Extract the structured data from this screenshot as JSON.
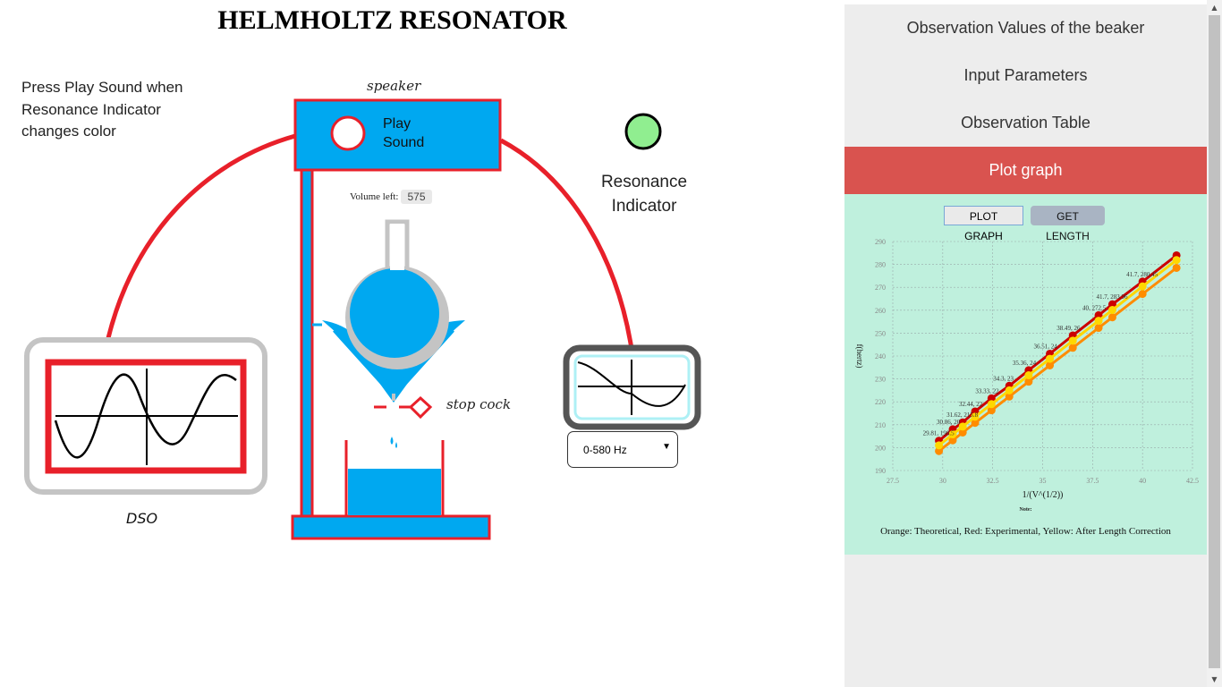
{
  "title": "HELMHOLTZ RESONATOR",
  "instruction": "Press Play Sound when Resonance Indicator changes color",
  "speaker": {
    "label": "speaker",
    "play_line1": "Play",
    "play_line2": "Sound"
  },
  "volume": {
    "label": "Volume left:",
    "value": "575"
  },
  "stopcock_label": "stop cock",
  "dso_label": "DSO",
  "resonance": {
    "line1": "Resonance",
    "line2": "Indicator",
    "indicator_color": "#90ee90"
  },
  "frequency_select": {
    "selected": "0-580 Hz"
  },
  "panel": {
    "sections": [
      "Observation Values of the beaker",
      "Input Parameters",
      "Observation Table",
      "Plot graph"
    ],
    "active_section": "Plot graph",
    "buttons": {
      "plot": "PLOT GRAPH",
      "get_length": "GET LENGTH"
    },
    "note": "Note:",
    "legend": "Orange: Theoretical, Red: Experimental, Yellow: After Length Correction"
  },
  "colors": {
    "accent_red": "#e8202a",
    "blue": "#00a8f0",
    "panel_active": "#d9534f",
    "plot_bg": "#bff0dd"
  },
  "chart_data": {
    "type": "line",
    "xlabel": "1/(V^(1/2))",
    "ylabel": "f(hertz)",
    "xlim": [
      27.5,
      42.5
    ],
    "ylim": [
      190,
      290
    ],
    "xticks": [
      "27.5",
      "30",
      "32.5",
      "35",
      "37.5",
      "40",
      "42.5"
    ],
    "yticks": [
      "190",
      "200",
      "210",
      "220",
      "230",
      "240",
      "250",
      "260",
      "270",
      "280",
      "290"
    ],
    "grid": true,
    "series": [
      {
        "color": "#ff8c00",
        "x": [
          29.81,
          30.5,
          31.0,
          31.62,
          32.44,
          33.33,
          34.3,
          35.36,
          36.51,
          37.8,
          38.49,
          40.0,
          41.7
        ],
        "y": [
          198.5,
          203.2,
          206.6,
          210.8,
          216.3,
          222.3,
          228.8,
          235.9,
          243.6,
          252.3,
          256.9,
          267.1,
          278.5
        ]
      },
      {
        "color": "#cc0000",
        "x": [
          29.81,
          30.5,
          31.0,
          31.62,
          32.44,
          33.33,
          34.3,
          35.36,
          36.51,
          37.8,
          38.49,
          40.0,
          41.7
        ],
        "y": [
          203.0,
          208.0,
          211.0,
          215.8,
          221.5,
          227.0,
          233.8,
          241.0,
          249.0,
          257.8,
          262.6,
          272.5,
          283.96
        ]
      },
      {
        "color": "#ffd700",
        "x": [
          29.81,
          30.5,
          31.0,
          31.62,
          32.44,
          33.33,
          34.3,
          35.36,
          36.51,
          37.8,
          38.49,
          40.0,
          41.7
        ],
        "y": [
          201.0,
          205.8,
          209.2,
          213.5,
          219.0,
          225.0,
          231.6,
          238.8,
          246.7,
          255.4,
          260.1,
          270.4,
          281.9
        ]
      }
    ],
    "annotations": [
      "29.81, 198.5",
      "30.86, 20",
      "31.62, 215.8",
      "32.44, 22",
      "33.33, 22",
      "34.3, 23",
      "35.36, 24",
      "36.51, 24",
      "38.49, 26",
      "40, 272.5",
      "41.7, 283.96",
      "41.7, 280.45"
    ]
  }
}
